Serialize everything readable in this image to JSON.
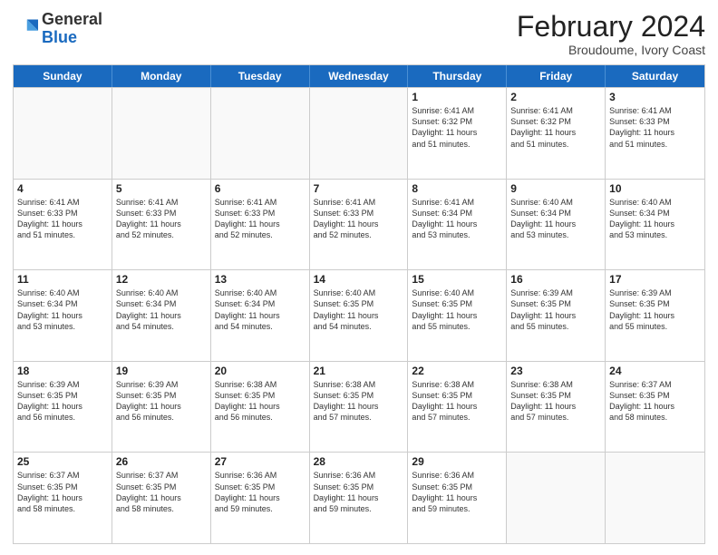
{
  "header": {
    "logo_general": "General",
    "logo_blue": "Blue",
    "month_title": "February 2024",
    "subtitle": "Broudoume, Ivory Coast"
  },
  "days_of_week": [
    "Sunday",
    "Monday",
    "Tuesday",
    "Wednesday",
    "Thursday",
    "Friday",
    "Saturday"
  ],
  "rows": [
    [
      {
        "day": "",
        "lines": [],
        "empty": true
      },
      {
        "day": "",
        "lines": [],
        "empty": true
      },
      {
        "day": "",
        "lines": [],
        "empty": true
      },
      {
        "day": "",
        "lines": [],
        "empty": true
      },
      {
        "day": "1",
        "lines": [
          "Sunrise: 6:41 AM",
          "Sunset: 6:32 PM",
          "Daylight: 11 hours",
          "and 51 minutes."
        ]
      },
      {
        "day": "2",
        "lines": [
          "Sunrise: 6:41 AM",
          "Sunset: 6:32 PM",
          "Daylight: 11 hours",
          "and 51 minutes."
        ]
      },
      {
        "day": "3",
        "lines": [
          "Sunrise: 6:41 AM",
          "Sunset: 6:33 PM",
          "Daylight: 11 hours",
          "and 51 minutes."
        ]
      }
    ],
    [
      {
        "day": "4",
        "lines": [
          "Sunrise: 6:41 AM",
          "Sunset: 6:33 PM",
          "Daylight: 11 hours",
          "and 51 minutes."
        ]
      },
      {
        "day": "5",
        "lines": [
          "Sunrise: 6:41 AM",
          "Sunset: 6:33 PM",
          "Daylight: 11 hours",
          "and 52 minutes."
        ]
      },
      {
        "day": "6",
        "lines": [
          "Sunrise: 6:41 AM",
          "Sunset: 6:33 PM",
          "Daylight: 11 hours",
          "and 52 minutes."
        ]
      },
      {
        "day": "7",
        "lines": [
          "Sunrise: 6:41 AM",
          "Sunset: 6:33 PM",
          "Daylight: 11 hours",
          "and 52 minutes."
        ]
      },
      {
        "day": "8",
        "lines": [
          "Sunrise: 6:41 AM",
          "Sunset: 6:34 PM",
          "Daylight: 11 hours",
          "and 53 minutes."
        ]
      },
      {
        "day": "9",
        "lines": [
          "Sunrise: 6:40 AM",
          "Sunset: 6:34 PM",
          "Daylight: 11 hours",
          "and 53 minutes."
        ]
      },
      {
        "day": "10",
        "lines": [
          "Sunrise: 6:40 AM",
          "Sunset: 6:34 PM",
          "Daylight: 11 hours",
          "and 53 minutes."
        ]
      }
    ],
    [
      {
        "day": "11",
        "lines": [
          "Sunrise: 6:40 AM",
          "Sunset: 6:34 PM",
          "Daylight: 11 hours",
          "and 53 minutes."
        ]
      },
      {
        "day": "12",
        "lines": [
          "Sunrise: 6:40 AM",
          "Sunset: 6:34 PM",
          "Daylight: 11 hours",
          "and 54 minutes."
        ]
      },
      {
        "day": "13",
        "lines": [
          "Sunrise: 6:40 AM",
          "Sunset: 6:34 PM",
          "Daylight: 11 hours",
          "and 54 minutes."
        ]
      },
      {
        "day": "14",
        "lines": [
          "Sunrise: 6:40 AM",
          "Sunset: 6:35 PM",
          "Daylight: 11 hours",
          "and 54 minutes."
        ]
      },
      {
        "day": "15",
        "lines": [
          "Sunrise: 6:40 AM",
          "Sunset: 6:35 PM",
          "Daylight: 11 hours",
          "and 55 minutes."
        ]
      },
      {
        "day": "16",
        "lines": [
          "Sunrise: 6:39 AM",
          "Sunset: 6:35 PM",
          "Daylight: 11 hours",
          "and 55 minutes."
        ]
      },
      {
        "day": "17",
        "lines": [
          "Sunrise: 6:39 AM",
          "Sunset: 6:35 PM",
          "Daylight: 11 hours",
          "and 55 minutes."
        ]
      }
    ],
    [
      {
        "day": "18",
        "lines": [
          "Sunrise: 6:39 AM",
          "Sunset: 6:35 PM",
          "Daylight: 11 hours",
          "and 56 minutes."
        ]
      },
      {
        "day": "19",
        "lines": [
          "Sunrise: 6:39 AM",
          "Sunset: 6:35 PM",
          "Daylight: 11 hours",
          "and 56 minutes."
        ]
      },
      {
        "day": "20",
        "lines": [
          "Sunrise: 6:38 AM",
          "Sunset: 6:35 PM",
          "Daylight: 11 hours",
          "and 56 minutes."
        ]
      },
      {
        "day": "21",
        "lines": [
          "Sunrise: 6:38 AM",
          "Sunset: 6:35 PM",
          "Daylight: 11 hours",
          "and 57 minutes."
        ]
      },
      {
        "day": "22",
        "lines": [
          "Sunrise: 6:38 AM",
          "Sunset: 6:35 PM",
          "Daylight: 11 hours",
          "and 57 minutes."
        ]
      },
      {
        "day": "23",
        "lines": [
          "Sunrise: 6:38 AM",
          "Sunset: 6:35 PM",
          "Daylight: 11 hours",
          "and 57 minutes."
        ]
      },
      {
        "day": "24",
        "lines": [
          "Sunrise: 6:37 AM",
          "Sunset: 6:35 PM",
          "Daylight: 11 hours",
          "and 58 minutes."
        ]
      }
    ],
    [
      {
        "day": "25",
        "lines": [
          "Sunrise: 6:37 AM",
          "Sunset: 6:35 PM",
          "Daylight: 11 hours",
          "and 58 minutes."
        ]
      },
      {
        "day": "26",
        "lines": [
          "Sunrise: 6:37 AM",
          "Sunset: 6:35 PM",
          "Daylight: 11 hours",
          "and 58 minutes."
        ]
      },
      {
        "day": "27",
        "lines": [
          "Sunrise: 6:36 AM",
          "Sunset: 6:35 PM",
          "Daylight: 11 hours",
          "and 59 minutes."
        ]
      },
      {
        "day": "28",
        "lines": [
          "Sunrise: 6:36 AM",
          "Sunset: 6:35 PM",
          "Daylight: 11 hours",
          "and 59 minutes."
        ]
      },
      {
        "day": "29",
        "lines": [
          "Sunrise: 6:36 AM",
          "Sunset: 6:35 PM",
          "Daylight: 11 hours",
          "and 59 minutes."
        ]
      },
      {
        "day": "",
        "lines": [],
        "empty": true
      },
      {
        "day": "",
        "lines": [],
        "empty": true
      }
    ]
  ]
}
